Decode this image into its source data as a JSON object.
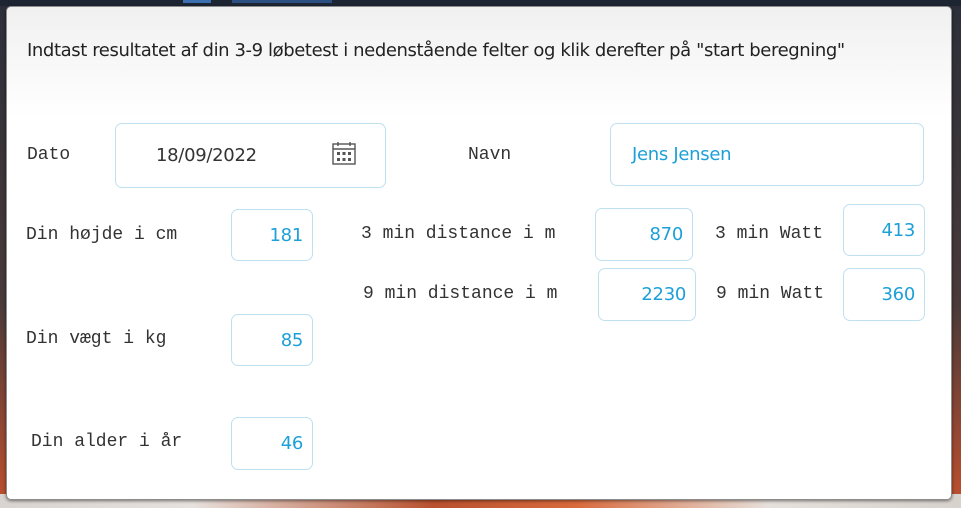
{
  "form": {
    "instructions": "Indtast resultatet af din 3-9 løbetest i nedenstående felter og klik derefter på \"start beregning\"",
    "date_label": "Dato",
    "date_value": "18/09/2022",
    "name_label": "Navn",
    "name_value": "Jens Jensen",
    "height_label": "Din højde i cm",
    "height_value": "181",
    "weight_label": "Din vægt i kg",
    "weight_value": "85",
    "age_label": "Din alder i år",
    "age_value": "46",
    "dist3_label": "3 min distance i m",
    "dist3_value": "870",
    "dist9_label": "9 min distance i m",
    "dist9_value": "2230",
    "watt3_label": "3 min Watt",
    "watt3_value": "413",
    "watt9_label": "9 min Watt",
    "watt9_value": "360"
  },
  "icons": {
    "calendar": "calendar-icon"
  },
  "colors": {
    "value_text": "#1da0d8",
    "field_border": "#bfe0ef",
    "label_text": "#333333"
  }
}
